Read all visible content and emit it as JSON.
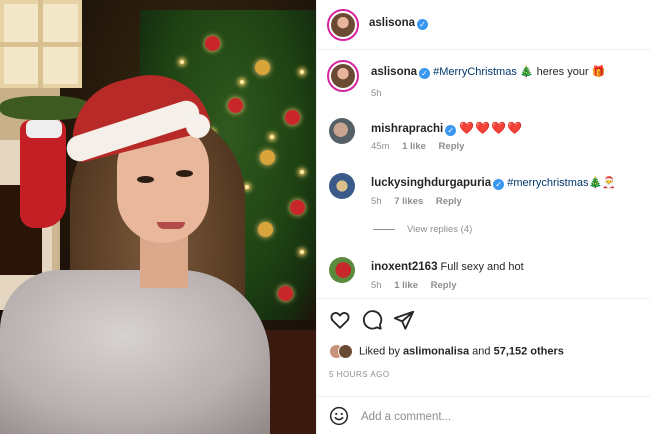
{
  "post": {
    "author": "aslisona",
    "verified": true
  },
  "caption": {
    "username": "aslisona",
    "hashtag": "#MerryChristmas",
    "text_after": "heres your",
    "emoji_tree": "🎄",
    "emoji_gift": "🎁",
    "time": "5h"
  },
  "comments": [
    {
      "username": "mishraprachi",
      "verified": true,
      "text": "",
      "emoji": "❤️❤️❤️❤️",
      "time": "45m",
      "likes": "1 like",
      "reply": "Reply"
    },
    {
      "username": "luckysinghdurgapuria",
      "verified": true,
      "hashtag": "#merrychristmas",
      "emoji": "🎄🎅",
      "time": "5h",
      "likes": "7 likes",
      "reply": "Reply",
      "view_replies": "View replies (4)"
    },
    {
      "username": "inoxent2163",
      "verified": false,
      "text": "Full sexy and hot",
      "time": "5h",
      "likes": "1 like",
      "reply": "Reply"
    }
  ],
  "liked_by": {
    "prefix": "Liked by",
    "user": "aslimonalisa",
    "and": "and",
    "count": "57,152 others"
  },
  "timestamp": "5 HOURS AGO",
  "add_comment": {
    "placeholder": "Add a comment..."
  },
  "icons": [
    "heart-icon",
    "comment-icon",
    "share-icon",
    "emoji-icon",
    "verified-icon"
  ],
  "colors": {
    "verified": "#3897f0",
    "hashtag": "#00376b",
    "muted": "#8e8e8e",
    "heart": "#e0245e"
  }
}
